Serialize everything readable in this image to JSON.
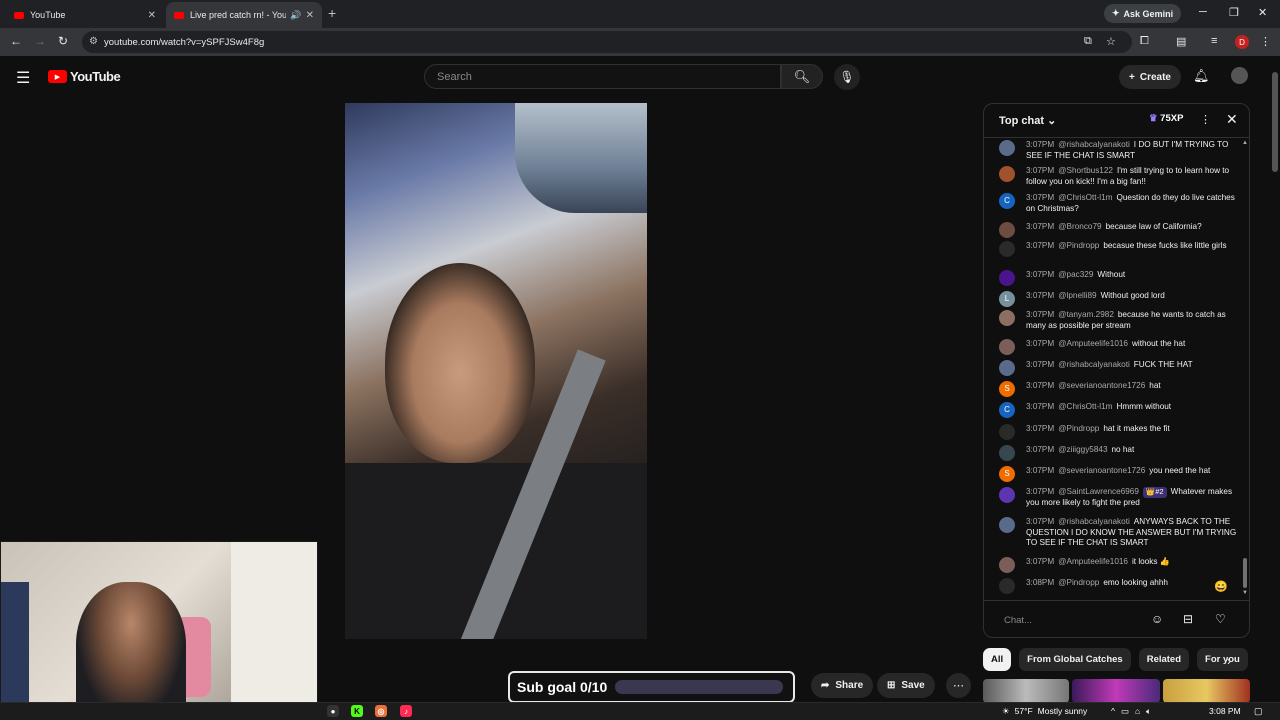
{
  "browser": {
    "tabs": [
      {
        "title": "YouTube"
      },
      {
        "title": "Live pred catch rn! - YouTub"
      }
    ],
    "new_tab": "+",
    "gemini_label": "Ask Gemini",
    "url": "youtube.com/watch?v=ySPFJSw4F8g",
    "profile_initial": "D"
  },
  "youtube": {
    "logo_text": "YouTube",
    "search_placeholder": "Search",
    "create_label": "Create"
  },
  "overlay": {
    "subgoal_label": "Sub goal 0/10",
    "subgoal_fraction": 0
  },
  "actions": {
    "share_label": "Share",
    "save_label": "Save"
  },
  "chat": {
    "title": "Top chat",
    "xp": "75XP",
    "input_placeholder": "Chat...",
    "messages": [
      {
        "time": "3:07PM",
        "user": "@rishabcalyanakoti",
        "text": "I DO BUT I'M TRYING TO SEE IF THE CHAT IS SMART",
        "avatar": "",
        "color": "#5a6a8a"
      },
      {
        "time": "3:07PM",
        "user": "@Shortbus122",
        "text": "I'm still trying to to learn how to follow you on kick!! I'm a big fan!!",
        "avatar": "",
        "color": "#a0522d"
      },
      {
        "time": "3:07PM",
        "user": "@ChrisOtt-l1m",
        "text": "Question do they do live catches on Christmas?",
        "avatar": "C",
        "color": "#1565c0"
      },
      {
        "time": "3:07PM",
        "user": "@Bronco79",
        "text": "because law of California?",
        "avatar": "",
        "color": "#6d4c41"
      },
      {
        "time": "3:07PM",
        "user": "@Pindropp",
        "text": "becasue these fucks like little girls",
        "avatar": "",
        "color": "#2a2a2a"
      },
      {
        "time": "3:07PM",
        "user": "@pac329",
        "text": "Without",
        "avatar": "",
        "color": "#4a148c"
      },
      {
        "time": "3:07PM",
        "user": "@lpnelli89",
        "text": "Without good lord",
        "avatar": "L",
        "color": "#78909c"
      },
      {
        "time": "3:07PM",
        "user": "@tanyam.2982",
        "text": "because he wants to catch as many as possible per stream",
        "avatar": "",
        "color": "#8d6e63"
      },
      {
        "time": "3:07PM",
        "user": "@Amputeelife1016",
        "text": "without the hat",
        "avatar": "",
        "color": "#7b5e57"
      },
      {
        "time": "3:07PM",
        "user": "@rishabcalyanakoti",
        "text": "FUCK THE HAT",
        "avatar": "",
        "color": "#5a6a8a"
      },
      {
        "time": "3:07PM",
        "user": "@severianoantone1726",
        "text": "hat",
        "avatar": "S",
        "color": "#ef6c00"
      },
      {
        "time": "3:07PM",
        "user": "@ChrisOtt-l1m",
        "text": "Hmmm without",
        "avatar": "C",
        "color": "#1565c0"
      },
      {
        "time": "3:07PM",
        "user": "@Pindropp",
        "text": "hat it makes the fit",
        "avatar": "",
        "color": "#2a2a2a"
      },
      {
        "time": "3:07PM",
        "user": "@ziiiggy5843",
        "text": "no hat",
        "avatar": "",
        "color": "#37474f"
      },
      {
        "time": "3:07PM",
        "user": "@severianoantone1726",
        "text": "you need the hat",
        "avatar": "S",
        "color": "#ef6c00"
      },
      {
        "time": "3:07PM",
        "user": "@SaintLawrence6969",
        "badge": "👑#2",
        "text": "Whatever makes you more likely to fight the pred",
        "avatar": "",
        "color": "#5e35b1"
      },
      {
        "time": "3:07PM",
        "user": "@rishabcalyanakoti",
        "text": "ANYWAYS BACK TO THE QUESTION I DO KNOW THE ANSWER BUT I'M TRYING TO SEE IF THE CHAT IS SMART",
        "avatar": "",
        "color": "#5a6a8a"
      },
      {
        "time": "3:07PM",
        "user": "@Amputeelife1016",
        "text": "it looks 👍",
        "avatar": "",
        "color": "#7b5e57"
      },
      {
        "time": "3:08PM",
        "user": "@Pindropp",
        "text": "emo looking ahhh",
        "avatar": "",
        "color": "#2a2a2a"
      }
    ]
  },
  "chips": [
    {
      "label": "All",
      "active": true
    },
    {
      "label": "From Global Catches",
      "active": false
    },
    {
      "label": "Related",
      "active": false
    },
    {
      "label": "For you",
      "active": false
    }
  ],
  "taskbar": {
    "temperature": "57°F",
    "weather": "Mostly sunny",
    "time": "3:08 PM"
  },
  "icons": {
    "menu": "menu-icon",
    "search": "search-icon",
    "mic": "mic-icon",
    "bell": "bell-icon",
    "share": "share-icon",
    "save": "bookmark-icon",
    "emoji": "emoji-icon",
    "money": "super-chat-icon",
    "heart": "heart-icon"
  }
}
